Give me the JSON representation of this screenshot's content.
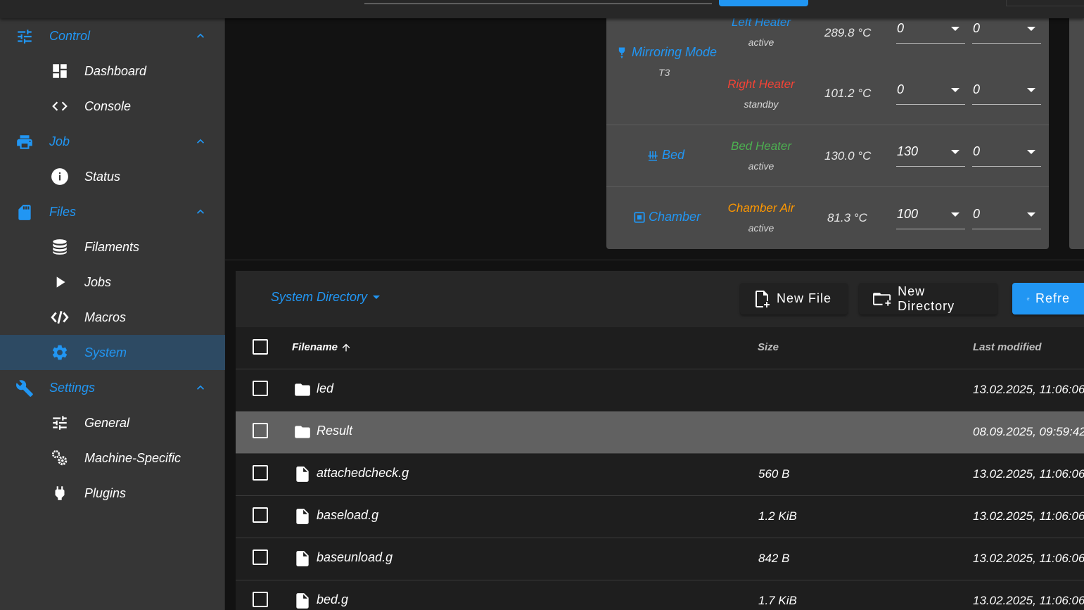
{
  "sidebar": {
    "groups": [
      {
        "label": "Control",
        "icon": "tune-icon",
        "items": [
          {
            "label": "Dashboard",
            "icon": "dashboard-icon"
          },
          {
            "label": "Console",
            "icon": "code-icon"
          }
        ]
      },
      {
        "label": "Job",
        "icon": "printer-icon",
        "items": [
          {
            "label": "Status",
            "icon": "info-icon"
          }
        ]
      },
      {
        "label": "Files",
        "icon": "sd-card-icon",
        "items": [
          {
            "label": "Filaments",
            "icon": "database-icon"
          },
          {
            "label": "Jobs",
            "icon": "play-icon"
          },
          {
            "label": "Macros",
            "icon": "code-slash-icon"
          },
          {
            "label": "System",
            "icon": "gear-icon"
          }
        ]
      },
      {
        "label": "Settings",
        "icon": "wrench-icon",
        "items": [
          {
            "label": "General",
            "icon": "sliders-icon"
          },
          {
            "label": "Machine-Specific",
            "icon": "cogs-icon"
          },
          {
            "label": "Plugins",
            "icon": "plug-icon"
          }
        ]
      }
    ],
    "active_item": "System"
  },
  "tools": {
    "mirroring": {
      "label": "Mirroring Mode",
      "sub": "T3",
      "heaters": [
        {
          "name": "Left Heater",
          "state": "active",
          "temp": "289.8 °C",
          "active": "0",
          "standby": "0",
          "color": "#2196f3"
        },
        {
          "name": "Right Heater",
          "state": "standby",
          "temp": "101.2 °C",
          "active": "0",
          "standby": "0",
          "color": "#f44336"
        }
      ]
    },
    "bed": {
      "label": "Bed",
      "heater": "Bed Heater",
      "state": "active",
      "temp": "130.0 °C",
      "active": "130",
      "standby": "0",
      "color": "#4caf50"
    },
    "chamber": {
      "label": "Chamber",
      "heater": "Chamber Air",
      "state": "active",
      "temp": "81.3 °C",
      "active": "100",
      "standby": "0",
      "color": "#ff9800"
    }
  },
  "files": {
    "directory": "System Directory",
    "buttons": {
      "new_file": "New File",
      "new_directory": "New Directory",
      "refresh": "Refre"
    },
    "columns": {
      "filename": "Filename",
      "size": "Size",
      "modified": "Last modified"
    },
    "rows": [
      {
        "type": "folder",
        "name": "led",
        "size": "",
        "modified": "13.02.2025, 11:06:06"
      },
      {
        "type": "folder",
        "name": "Result",
        "size": "",
        "modified": "08.09.2025, 09:59:42"
      },
      {
        "type": "file",
        "name": "attachedcheck.g",
        "size": "560 B",
        "modified": "13.02.2025, 11:06:06"
      },
      {
        "type": "file",
        "name": "baseload.g",
        "size": "1.2 KiB",
        "modified": "13.02.2025, 11:06:06"
      },
      {
        "type": "file",
        "name": "baseunload.g",
        "size": "842 B",
        "modified": "13.02.2025, 11:06:06"
      },
      {
        "type": "file",
        "name": "bed.g",
        "size": "1.7 KiB",
        "modified": "13.02.2025, 11:06:06"
      }
    ],
    "highlighted_row": "Result"
  }
}
